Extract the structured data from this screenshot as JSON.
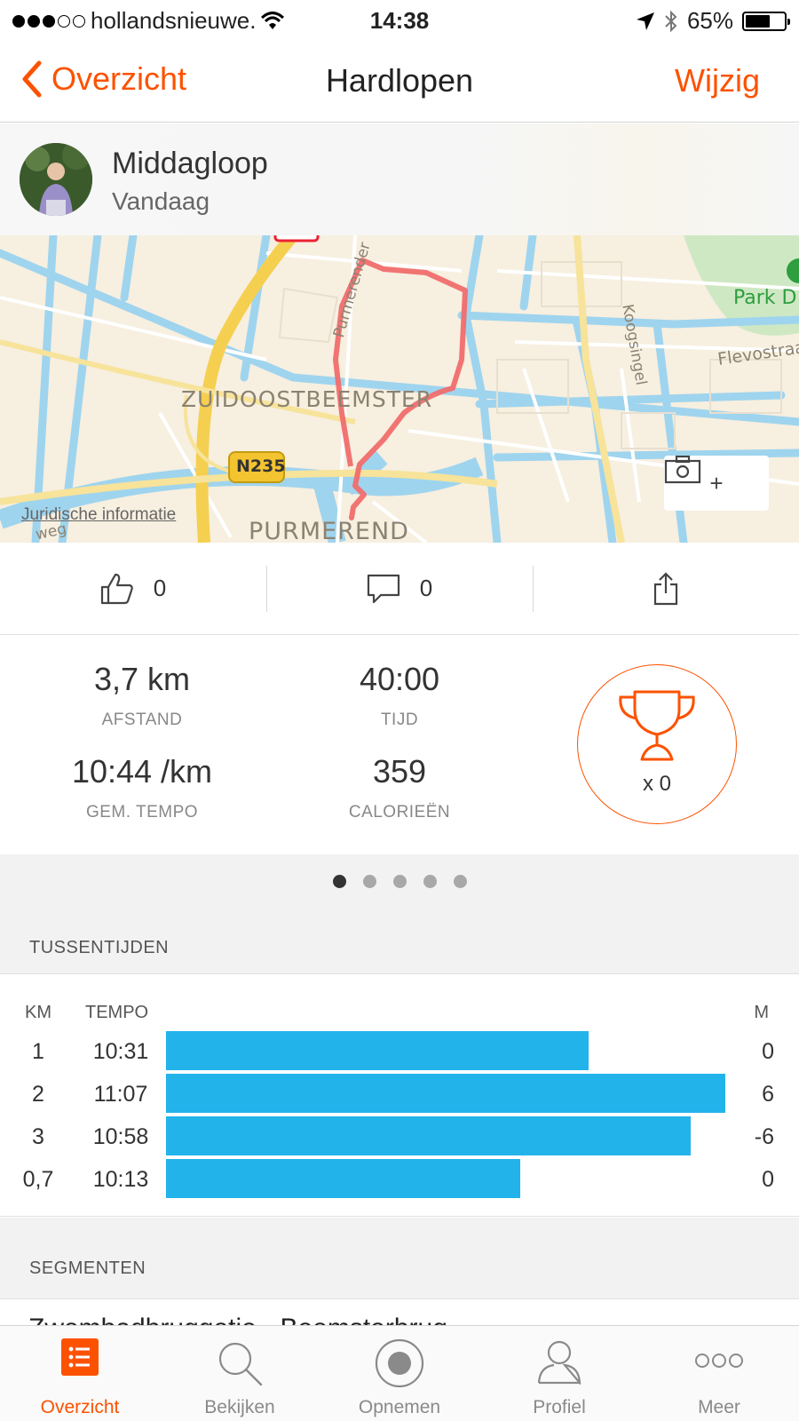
{
  "status_bar": {
    "carrier": "hollandsnieuwe.",
    "time": "14:38",
    "battery": "65%"
  },
  "nav": {
    "back_label": "Overzicht",
    "title": "Hardlopen",
    "edit_label": "Wijzig"
  },
  "activity": {
    "name": "Middagloop",
    "date": "Vandaag"
  },
  "map": {
    "labels": {
      "district": "ZUIDOOSTBEEMSTER",
      "city": "PURMEREND",
      "road": "N235",
      "park": "Park D",
      "street1": "Koogsingel",
      "street2": "Flevostraa",
      "street3": "Purmerender",
      "street4": "weg"
    },
    "legal": "Juridische informatie",
    "add_photo_plus": "+"
  },
  "social": {
    "kudos_count": "0",
    "comments_count": "0"
  },
  "stats": {
    "distance_value": "3,7 km",
    "distance_label": "AFSTAND",
    "time_value": "40:00",
    "time_label": "TIJD",
    "pace_value": "10:44 /km",
    "pace_label": "GEM. TEMPO",
    "calories_value": "359",
    "calories_label": "CALORIEËN",
    "achievements": "x 0"
  },
  "pager": {
    "count": 5,
    "active": 0
  },
  "splits": {
    "section_title": "TUSSENTIJDEN",
    "col_km": "KM",
    "col_pace": "TEMPO",
    "col_elev": "M",
    "rows": [
      {
        "km": "1",
        "pace": "10:31",
        "pace_seconds": 631,
        "elev": "0"
      },
      {
        "km": "2",
        "pace": "11:07",
        "pace_seconds": 667,
        "elev": "6"
      },
      {
        "km": "3",
        "pace": "10:58",
        "pace_seconds": 658,
        "elev": "-6"
      },
      {
        "km": "0,7",
        "pace": "10:13",
        "pace_seconds": 613,
        "elev": "0"
      }
    ]
  },
  "segments": {
    "section_title": "SEGMENTEN",
    "first_item": "Zwembadbruggetje - Beemsterbrug"
  },
  "tabbar": {
    "items": [
      {
        "label": "Overzicht",
        "icon": "feed-list-icon"
      },
      {
        "label": "Bekijken",
        "icon": "search-icon"
      },
      {
        "label": "Opnemen",
        "icon": "record-icon"
      },
      {
        "label": "Profiel",
        "icon": "profile-icon"
      },
      {
        "label": "Meer",
        "icon": "more-icon"
      }
    ],
    "active": 0
  },
  "colors": {
    "accent": "#fc5200",
    "split_bar": "#22b3eb",
    "route": "#f06d6d"
  }
}
